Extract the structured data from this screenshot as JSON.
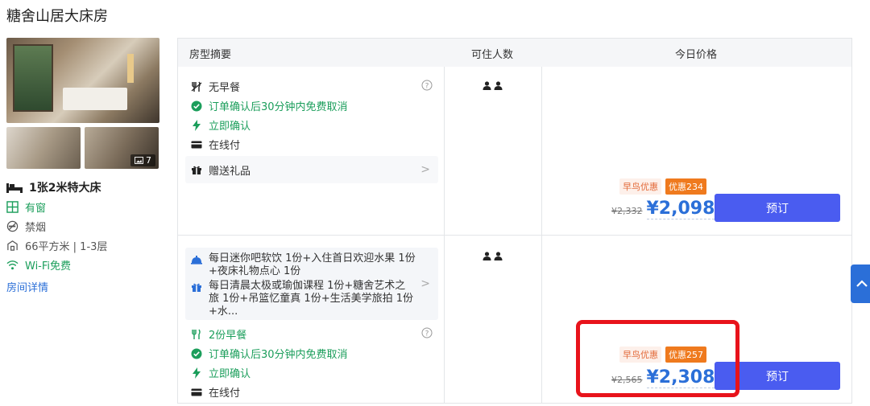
{
  "page_title": "糖舍山居大床房",
  "photos": {
    "count": "7"
  },
  "room": {
    "bed": "1张2米特大床",
    "amenities": [
      {
        "icon": "window-icon",
        "text": "有窗",
        "color": "#1b9e5b"
      },
      {
        "icon": "no-smoking-icon",
        "text": "禁烟",
        "color": "#555555"
      },
      {
        "icon": "area-icon",
        "text": "66平方米 | 1-3层",
        "color": "#555555"
      },
      {
        "icon": "wifi-icon",
        "text": "Wi-Fi免费",
        "color": "#1b9e5b"
      }
    ],
    "details_link": "房间详情"
  },
  "table": {
    "headers": {
      "summary": "房型摘要",
      "occupancy": "可住人数",
      "price": "今日价格"
    },
    "rows": [
      {
        "meal": "无早餐",
        "cancel": "订单确认后30分钟内免费取消",
        "confirm": "立即确认",
        "payment": "在线付",
        "gift": "赠送礼品",
        "early_bird": "早鸟优惠",
        "discount": "优惠234",
        "original_price": "¥2,332",
        "price": "¥2,098",
        "book": "预订"
      },
      {
        "perk1": "每日迷你吧软饮 1份+入住首日欢迎水果 1份+夜床礼物点心 1份",
        "perk2": "每日清晨太极或瑜伽课程 1份+糖舍艺术之旅 1份+吊篮忆童真 1份+生活美学旅拍 1份+水...",
        "meal": "2份早餐",
        "cancel": "订单确认后30分钟内免费取消",
        "confirm": "立即确认",
        "payment": "在线付",
        "early_bird": "早鸟优惠",
        "discount": "优惠257",
        "original_price": "¥2,565",
        "price": "¥2,308",
        "book": "预订"
      }
    ]
  },
  "colors": {
    "accent": "#2b6fd8",
    "book_button": "#4a5cf0",
    "success": "#1b9e5b",
    "discount": "#ef7a1e",
    "highlight": "#e8131b"
  }
}
